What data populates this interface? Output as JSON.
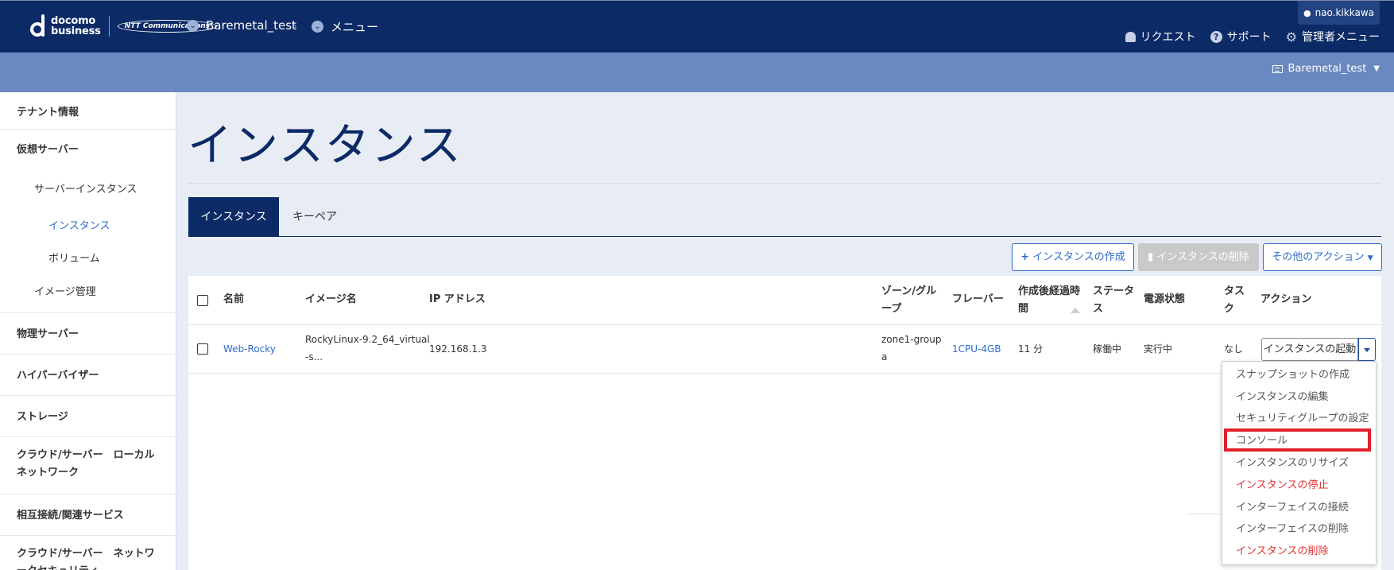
{
  "header": {
    "logo_text_line1": "docomo",
    "logo_text_line2": "business",
    "logo_partner": "NTT Communications",
    "breadcrumb": [
      "Baremetal_test",
      "メニュー"
    ],
    "user": "nao.kikkawa",
    "links": [
      {
        "icon": "bell-icon",
        "label": "リクエスト"
      },
      {
        "icon": "help-icon",
        "label": "サポート"
      },
      {
        "icon": "gear-icon",
        "label": "管理者メニュー"
      }
    ]
  },
  "subbar": {
    "tenant": "Baremetal_test"
  },
  "sidebar": {
    "items": [
      {
        "label": "テナント情報"
      },
      {
        "label": "仮想サーバー"
      },
      {
        "label": "サーバーインスタンス"
      },
      {
        "label": "インスタンス"
      },
      {
        "label": "ボリューム"
      },
      {
        "label": "イメージ管理"
      },
      {
        "label": "物理サーバー"
      },
      {
        "label": "ハイパーバイザー"
      },
      {
        "label": "ストレージ"
      },
      {
        "label": "クラウド/サーバー　ローカルネットワーク"
      },
      {
        "label": "相互接続/関連サービス"
      },
      {
        "label": "クラウド/サーバー　ネットワークセキュリティ"
      }
    ]
  },
  "main": {
    "title": "インスタンス",
    "tabs": [
      "インスタンス",
      "キーペア"
    ],
    "buttons": {
      "create": "インスタンスの作成",
      "delete": "インスタンスの削除",
      "other": "その他のアクション"
    },
    "table": {
      "headers": {
        "name": "名前",
        "image": "イメージ名",
        "ip": "IP アドレス",
        "zone_1": "ゾーン/グル",
        "zone_2": "ープ",
        "flavor": "フレーバー",
        "age_1": "作成後経過時",
        "age_2": "間",
        "status_1": "ステータ",
        "status_2": "ス",
        "power": "電源状態",
        "task_1": "タス",
        "task_2": "ク",
        "action": "アクション"
      },
      "rows": [
        {
          "name": "Web-Rocky",
          "image_1": "RockyLinux-9.2_64_virtual",
          "image_2": "-s...",
          "ip": "192.168.1.3",
          "zone_1": "zone1-group",
          "zone_2": "a",
          "flavor": "1CPU-4GB",
          "age": "11 分",
          "status": "稼働中",
          "power": "実行中",
          "task": "なし",
          "action": "インスタンスの起動"
        }
      ]
    },
    "dropdown": [
      {
        "label": "スナップショットの作成",
        "danger": false
      },
      {
        "label": "インスタンスの編集",
        "danger": false
      },
      {
        "label": "セキュリティグループの設定",
        "danger": false
      },
      {
        "label": "コンソール",
        "danger": false
      },
      {
        "label": "インスタンスのリサイズ",
        "danger": false
      },
      {
        "label": "インスタンスの停止",
        "danger": true
      },
      {
        "label": "インターフェイスの接続",
        "danger": false
      },
      {
        "label": "インターフェイスの削除",
        "danger": false
      },
      {
        "label": "インスタンスの削除",
        "danger": true
      }
    ],
    "colors": {
      "navy": "#0b2a66",
      "link": "#2e6cc7",
      "danger": "#e03131",
      "highlight": "#e0202a"
    }
  }
}
